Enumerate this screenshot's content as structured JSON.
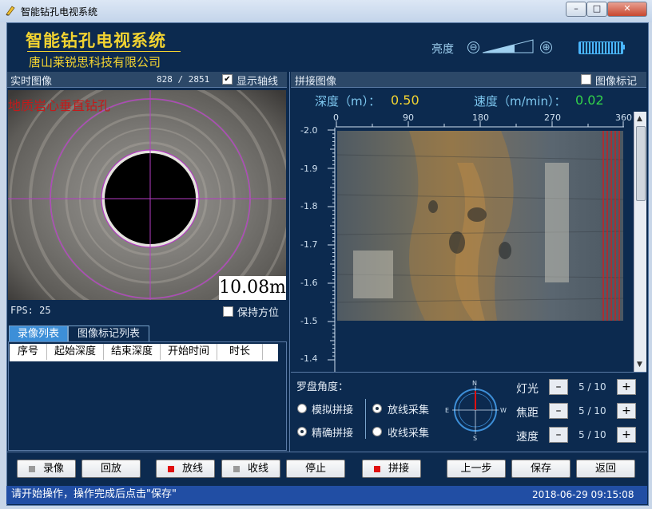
{
  "window": {
    "title": "智能钻孔电视系统",
    "minimize": "–",
    "maximize": "□",
    "close": "✕"
  },
  "header": {
    "app_title": "智能钻孔电视系统",
    "company": "唐山莱锐思科技有限公司",
    "brightness_label": "亮度",
    "brightness_minus": "⊖",
    "brightness_plus": "⊕"
  },
  "realtime": {
    "title": "实时图像",
    "frame_counter": "828 / 2851",
    "show_axis_label": "显示轴线",
    "show_axis_checked": true,
    "overlay_text": "地质岩心垂直钻孔",
    "depth_overlay": "10.08m",
    "fps": "FPS: 25",
    "keep_orientation_label": "保持方位",
    "keep_orientation_checked": false
  },
  "tabs": [
    {
      "label": "录像列表",
      "active": true
    },
    {
      "label": "图像标记列表",
      "active": false
    }
  ],
  "table": {
    "columns": [
      "序号",
      "起始深度",
      "结束深度",
      "开始时间",
      "时长"
    ]
  },
  "mosaic": {
    "title": "拼接图像",
    "mark_label": "图像标记",
    "mark_checked": false,
    "depth_label": "深度（m）：",
    "depth_value": "0.50",
    "speed_label": "速度（m/min）：",
    "speed_value": "0.02",
    "angle_ticks": [
      "0",
      "90",
      "180",
      "270",
      "360"
    ],
    "depth_ticks": [
      "-2.0",
      "-1.9",
      "-1.8",
      "-1.7",
      "-1.6",
      "-1.5",
      "-1.4"
    ]
  },
  "compass": {
    "label": "罗盘角度：",
    "simulate": "模拟拼接",
    "precise": "精确拼接",
    "precise_selected": true,
    "simulate_selected": false,
    "release": "放线采集",
    "retract": "收线采集",
    "release_selected": true,
    "retract_selected": false,
    "n": "N",
    "s": "S",
    "e": "E",
    "w": "W"
  },
  "controls": [
    {
      "label": "灯光",
      "value": "5 / 10"
    },
    {
      "label": "焦距",
      "value": "5 / 10"
    },
    {
      "label": "速度",
      "value": "5 / 10"
    }
  ],
  "stepper": {
    "minus": "–",
    "plus": "+"
  },
  "buttons": {
    "record": "录像",
    "playback": "回放",
    "release": "放线",
    "retract": "收线",
    "stop": "停止",
    "stitch": "拼接",
    "prev": "上一步",
    "save": "保存",
    "back": "返回"
  },
  "colors": {
    "panel_bg": "#0c2a4f",
    "title_yellow": "#f2d331",
    "value_yellow": "#f2d331",
    "value_green": "#32d24a",
    "status_bar": "#214ea4",
    "red_indicator": "#e01010",
    "grey_indicator": "#9a9a9a"
  },
  "status": {
    "message": "请开始操作，操作完成后点击\"保存\"",
    "timestamp": "2018-06-29 09:15:08"
  }
}
